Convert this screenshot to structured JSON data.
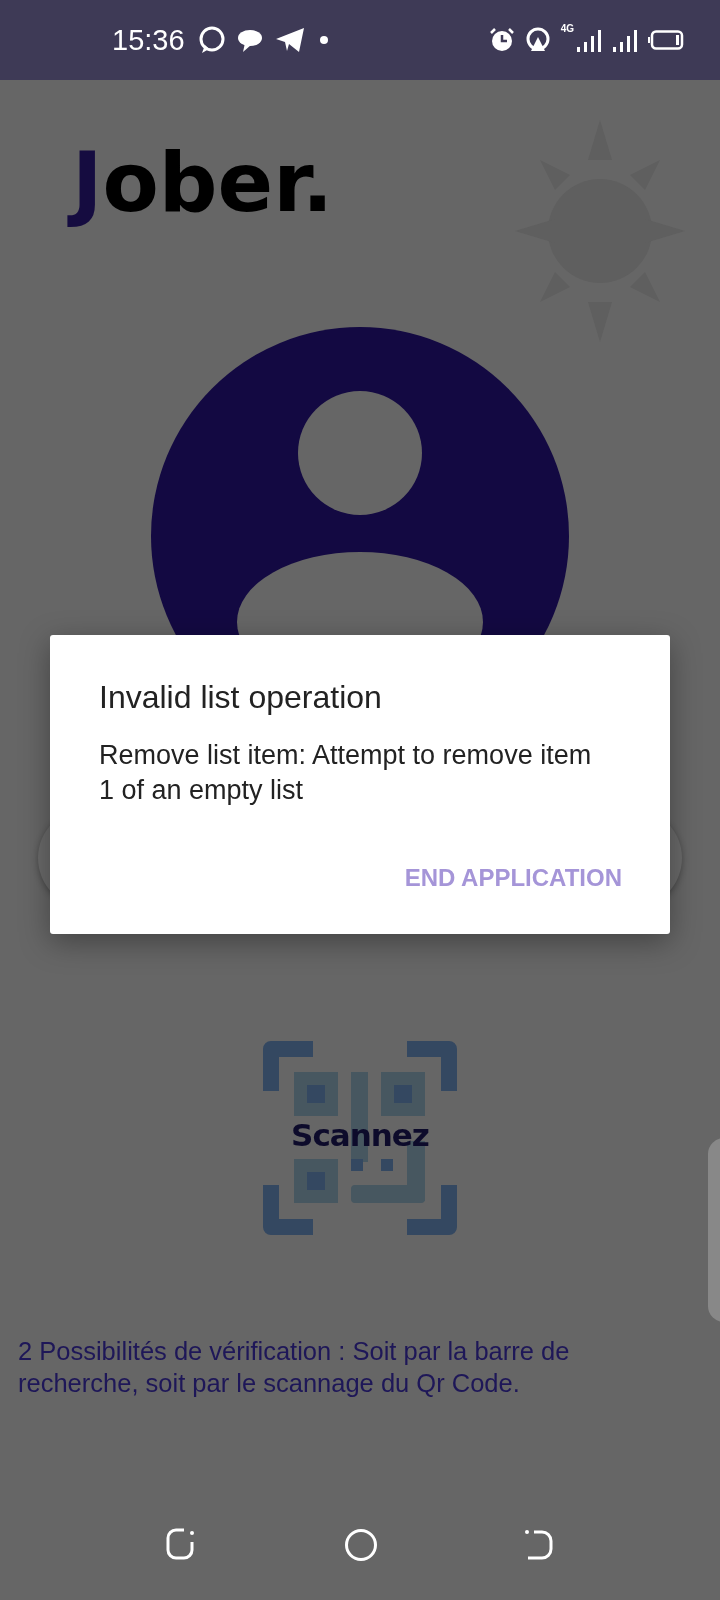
{
  "status_bar": {
    "time": "15:36",
    "network": "4G"
  },
  "logo": {
    "initial": "J",
    "rest": "ober."
  },
  "scan": {
    "label": "Scannez"
  },
  "hint": "2 Possibilités de vérification : Soit par la barre de recherche, soit par le scannage du Qr Code.",
  "dialog": {
    "title": "Invalid list operation",
    "message": "Remove list item: Attempt to remove item 1 of an empty list",
    "button": "END APPLICATION"
  }
}
